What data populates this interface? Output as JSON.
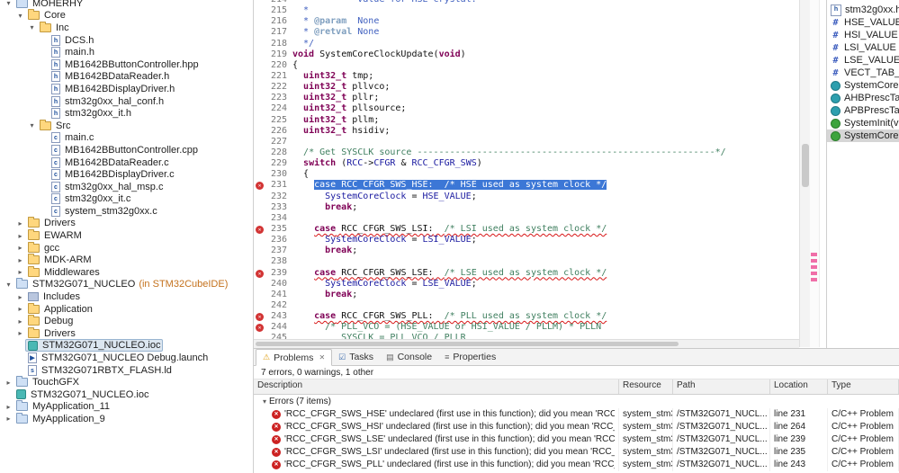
{
  "explorer": {
    "items": [
      {
        "l": "MOHERHY",
        "v": 0,
        "a": "o",
        "i": "project"
      },
      {
        "l": "Core",
        "v": 1,
        "a": "o",
        "i": "folder"
      },
      {
        "l": "Inc",
        "v": 2,
        "a": "o",
        "i": "folder"
      },
      {
        "l": "DCS.h",
        "v": 3,
        "a": "",
        "i": "h"
      },
      {
        "l": "main.h",
        "v": 3,
        "a": "",
        "i": "h"
      },
      {
        "l": "MB1642BButtonController.hpp",
        "v": 3,
        "a": "",
        "i": "hpp"
      },
      {
        "l": "MB1642BDataReader.h",
        "v": 3,
        "a": "",
        "i": "h"
      },
      {
        "l": "MB1642BDisplayDriver.h",
        "v": 3,
        "a": "",
        "i": "h"
      },
      {
        "l": "stm32g0xx_hal_conf.h",
        "v": 3,
        "a": "",
        "i": "h"
      },
      {
        "l": "stm32g0xx_it.h",
        "v": 3,
        "a": "",
        "i": "h"
      },
      {
        "l": "Src",
        "v": 2,
        "a": "o",
        "i": "folder"
      },
      {
        "l": "main.c",
        "v": 3,
        "a": "",
        "i": "c"
      },
      {
        "l": "MB1642BButtonController.cpp",
        "v": 3,
        "a": "",
        "i": "cpp"
      },
      {
        "l": "MB1642BDataReader.c",
        "v": 3,
        "a": "",
        "i": "c"
      },
      {
        "l": "MB1642BDisplayDriver.c",
        "v": 3,
        "a": "",
        "i": "c"
      },
      {
        "l": "stm32g0xx_hal_msp.c",
        "v": 3,
        "a": "",
        "i": "c"
      },
      {
        "l": "stm32g0xx_it.c",
        "v": 3,
        "a": "",
        "i": "c"
      },
      {
        "l": "system_stm32g0xx.c",
        "v": 3,
        "a": "",
        "i": "c"
      },
      {
        "l": "Drivers",
        "v": 1,
        "a": "c",
        "i": "folder"
      },
      {
        "l": "EWARM",
        "v": 1,
        "a": "c",
        "i": "folder"
      },
      {
        "l": "gcc",
        "v": 1,
        "a": "c",
        "i": "folder"
      },
      {
        "l": "MDK-ARM",
        "v": 1,
        "a": "c",
        "i": "folder"
      },
      {
        "l": "Middlewares",
        "v": 1,
        "a": "c",
        "i": "folder"
      },
      {
        "l": "STM32G071_NUCLEO",
        "v": 0,
        "a": "o",
        "i": "project",
        "q": "(in STM32CubeIDE)"
      },
      {
        "l": "Includes",
        "v": 1,
        "a": "c",
        "i": "includes"
      },
      {
        "l": "Application",
        "v": 1,
        "a": "c",
        "i": "folder"
      },
      {
        "l": "Debug",
        "v": 1,
        "a": "c",
        "i": "folder"
      },
      {
        "l": "Drivers",
        "v": 1,
        "a": "c",
        "i": "folder"
      },
      {
        "l": "STM32G071_NUCLEO.ioc",
        "v": 1,
        "a": "",
        "i": "ioc",
        "sel": 1
      },
      {
        "l": "STM32G071_NUCLEO Debug.launch",
        "v": 1,
        "a": "",
        "i": "launch"
      },
      {
        "l": "STM32G071RBTX_FLASH.ld",
        "v": 1,
        "a": "",
        "i": "ld"
      },
      {
        "l": "TouchGFX",
        "v": 0,
        "a": "c",
        "i": "project"
      },
      {
        "l": "STM32G071_NUCLEO.ioc",
        "v": 0,
        "a": "",
        "i": "ioc"
      },
      {
        "l": "MyApplication_11",
        "v": 0,
        "a": "c",
        "i": "project"
      },
      {
        "l": "MyApplication_9",
        "v": 0,
        "a": "c",
        "i": "project"
      }
    ]
  },
  "editor": {
    "lines": [
      {
        "n": 214,
        "s": [
          [
            "  *         value for HSE crystal.",
            "dc"
          ]
        ]
      },
      {
        "n": 215,
        "s": [
          [
            "  *",
            "dc"
          ]
        ]
      },
      {
        "n": 216,
        "s": [
          [
            "  * ",
            "dc"
          ],
          [
            "@param",
            "dt"
          ],
          [
            "  None",
            "dc"
          ]
        ]
      },
      {
        "n": 217,
        "s": [
          [
            "  * ",
            "dc"
          ],
          [
            "@retval",
            "dt"
          ],
          [
            " None",
            "dc"
          ]
        ]
      },
      {
        "n": 218,
        "s": [
          [
            "  */",
            "dc"
          ]
        ]
      },
      {
        "n": 219,
        "s": [
          [
            "void",
            "kw"
          ],
          [
            " SystemCoreClockUpdate(",
            "pl"
          ],
          [
            "void",
            "kw"
          ],
          [
            ")",
            "pl"
          ]
        ]
      },
      {
        "n": 220,
        "s": [
          [
            "{",
            "pl"
          ]
        ]
      },
      {
        "n": 221,
        "s": [
          [
            "  ",
            "pl"
          ],
          [
            "uint32_t",
            "kw"
          ],
          [
            " tmp;",
            "pl"
          ]
        ]
      },
      {
        "n": 222,
        "s": [
          [
            "  ",
            "pl"
          ],
          [
            "uint32_t",
            "kw"
          ],
          [
            " pllvco;",
            "pl"
          ]
        ]
      },
      {
        "n": 223,
        "s": [
          [
            "  ",
            "pl"
          ],
          [
            "uint32_t",
            "kw"
          ],
          [
            " pllr;",
            "pl"
          ]
        ]
      },
      {
        "n": 224,
        "s": [
          [
            "  ",
            "pl"
          ],
          [
            "uint32_t",
            "kw"
          ],
          [
            " pllsource;",
            "pl"
          ]
        ]
      },
      {
        "n": 225,
        "s": [
          [
            "  ",
            "pl"
          ],
          [
            "uint32_t",
            "kw"
          ],
          [
            " pllm;",
            "pl"
          ]
        ]
      },
      {
        "n": 226,
        "s": [
          [
            "  ",
            "pl"
          ],
          [
            "uint32_t",
            "kw"
          ],
          [
            " hsidiv;",
            "pl"
          ]
        ]
      },
      {
        "n": 227,
        "s": []
      },
      {
        "n": 228,
        "s": [
          [
            "  ",
            "pl"
          ],
          [
            "/* Get SYSCLK source -------------------------------------------------------*/",
            "cm"
          ]
        ]
      },
      {
        "n": 229,
        "s": [
          [
            "  ",
            "pl"
          ],
          [
            "switch",
            "kw"
          ],
          [
            " (",
            "pl"
          ],
          [
            "RCC",
            "id"
          ],
          [
            "->",
            "pl"
          ],
          [
            "CFGR",
            "id"
          ],
          [
            " & ",
            "pl"
          ],
          [
            "RCC_CFGR_SWS",
            "id"
          ],
          [
            ")",
            "pl"
          ]
        ]
      },
      {
        "n": 230,
        "s": [
          [
            "  {",
            "pl"
          ]
        ]
      },
      {
        "n": 231,
        "m": 1,
        "s": [
          [
            "    ",
            "pl"
          ],
          [
            "case RCC_CFGR_SWS_HSE:  /* HSE used as system clock */",
            "sel"
          ]
        ]
      },
      {
        "n": 232,
        "s": [
          [
            "      ",
            "pl"
          ],
          [
            "SystemCoreClock",
            "id"
          ],
          [
            " = ",
            "pl"
          ],
          [
            "HSE_VALUE",
            "id"
          ],
          [
            ";",
            "pl"
          ]
        ]
      },
      {
        "n": 233,
        "s": [
          [
            "      ",
            "pl"
          ],
          [
            "break",
            "kw"
          ],
          [
            ";",
            "pl"
          ]
        ]
      },
      {
        "n": 234,
        "s": []
      },
      {
        "n": 235,
        "m": 1,
        "s": [
          [
            "    ",
            "pl"
          ],
          [
            "case",
            "kw err"
          ],
          [
            " ",
            "pl err"
          ],
          [
            "RCC_CFGR_SWS_LSI:",
            "pl err"
          ],
          [
            "  ",
            "pl err"
          ],
          [
            "/* LSI used as system clock */",
            "cm err"
          ]
        ]
      },
      {
        "n": 236,
        "s": [
          [
            "      ",
            "pl"
          ],
          [
            "SystemCoreClock",
            "id"
          ],
          [
            " = ",
            "pl"
          ],
          [
            "LSI_VALUE",
            "id"
          ],
          [
            ";",
            "pl"
          ]
        ]
      },
      {
        "n": 237,
        "s": [
          [
            "      ",
            "pl"
          ],
          [
            "break",
            "kw"
          ],
          [
            ";",
            "pl"
          ]
        ]
      },
      {
        "n": 238,
        "s": []
      },
      {
        "n": 239,
        "m": 1,
        "s": [
          [
            "    ",
            "pl"
          ],
          [
            "case",
            "kw err"
          ],
          [
            " ",
            "pl err"
          ],
          [
            "RCC_CFGR_SWS_LSE:",
            "pl err"
          ],
          [
            "  ",
            "pl err"
          ],
          [
            "/* LSE used as system clock */",
            "cm err"
          ]
        ]
      },
      {
        "n": 240,
        "s": [
          [
            "      ",
            "pl"
          ],
          [
            "SystemCoreClock",
            "id"
          ],
          [
            " = ",
            "pl"
          ],
          [
            "LSE_VALUE",
            "id"
          ],
          [
            ";",
            "pl"
          ]
        ]
      },
      {
        "n": 241,
        "s": [
          [
            "      ",
            "pl"
          ],
          [
            "break",
            "kw"
          ],
          [
            ";",
            "pl"
          ]
        ]
      },
      {
        "n": 242,
        "s": []
      },
      {
        "n": 243,
        "m": 1,
        "s": [
          [
            "    ",
            "pl"
          ],
          [
            "case",
            "kw err"
          ],
          [
            " ",
            "pl err"
          ],
          [
            "RCC_CFGR_SWS_PLL:",
            "pl err"
          ],
          [
            "  ",
            "pl err"
          ],
          [
            "/* PLL used as system clock */",
            "cm err"
          ]
        ]
      },
      {
        "n": 244,
        "m": 1,
        "s": [
          [
            "      ",
            "pl"
          ],
          [
            "/* PLL_VCO = (HSE_VALUE or HSI_VALUE / PLLM) * PLLN",
            "cm"
          ]
        ]
      },
      {
        "n": 245,
        "s": [
          [
            "         SYSCLK = PLL_VCO / PLLR",
            "cm"
          ]
        ]
      }
    ]
  },
  "outline": {
    "items": [
      {
        "l": "stm32g0xx.h",
        "i": "include"
      },
      {
        "l": "HSE_VALUE",
        "i": "define"
      },
      {
        "l": "HSI_VALUE",
        "i": "define"
      },
      {
        "l": "LSI_VALUE",
        "i": "define"
      },
      {
        "l": "LSE_VALUE",
        "i": "define"
      },
      {
        "l": "VECT_TAB_OFFSET",
        "i": "define"
      },
      {
        "l": "SystemCoreClock",
        "i": "variable"
      },
      {
        "l": "AHBPrescTable",
        "i": "variable"
      },
      {
        "l": "APBPrescTable",
        "i": "variable"
      },
      {
        "l": "SystemInit(void) : void",
        "i": "function"
      },
      {
        "l": "SystemCoreClockUpdate(void) : void",
        "i": "function",
        "sel": 1
      }
    ]
  },
  "problems": {
    "tabs": [
      {
        "label": "Problems",
        "icon": "problems",
        "selected": true
      },
      {
        "label": "Tasks",
        "icon": "tasks"
      },
      {
        "label": "Console",
        "icon": "console"
      },
      {
        "label": "Properties",
        "icon": "properties"
      }
    ],
    "summary": "7 errors, 0 warnings, 1 other",
    "columns": [
      "Description",
      "Resource",
      "Path",
      "Location",
      "Type"
    ],
    "group": {
      "label": "Errors (7 items)",
      "expanded": true
    },
    "rows": [
      {
        "description": "'RCC_CFGR_SWS_HSE' undeclared (first use in this function); did you mean 'RCC_CFGR_SWS_Ms...",
        "resource": "system_stm32g...",
        "path": "/STM32G071_NUCL...",
        "location": "line 231",
        "type": "C/C++ Problem"
      },
      {
        "description": "'RCC_CFGR_SWS_HSI' undeclared (first use in this function); did you mean 'RCC_CFGR_SWS_Ms...",
        "resource": "system_stm32g...",
        "path": "/STM32G071_NUCL...",
        "location": "line 264",
        "type": "C/C++ Problem"
      },
      {
        "description": "'RCC_CFGR_SWS_LSE' undeclared (first use in this function); did you mean 'RCC_CFGR_SWS_Msk...",
        "resource": "system_stm32g...",
        "path": "/STM32G071_NUCL...",
        "location": "line 239",
        "type": "C/C++ Problem"
      },
      {
        "description": "'RCC_CFGR_SWS_LSI' undeclared (first use in this function); did you mean 'RCC_CFGR_SWS_Msk...",
        "resource": "system_stm32g...",
        "path": "/STM32G071_NUCL...",
        "location": "line 235",
        "type": "C/C++ Problem"
      },
      {
        "description": "'RCC_CFGR_SWS_PLL' undeclared (first use in this function); did you mean 'RCC_CFGR_SWS_Pos...",
        "resource": "system_stm32g...",
        "path": "/STM32G071_NUCL...",
        "location": "line 243",
        "type": "C/C++ Problem"
      }
    ]
  },
  "colors": {
    "keyword": "#7f0055",
    "comment": "#3f7f5f",
    "doc_comment": "#3f5fbf",
    "selection": "#3c77d6",
    "error": "#d23434",
    "qualifier_orange": "#c4711c"
  }
}
